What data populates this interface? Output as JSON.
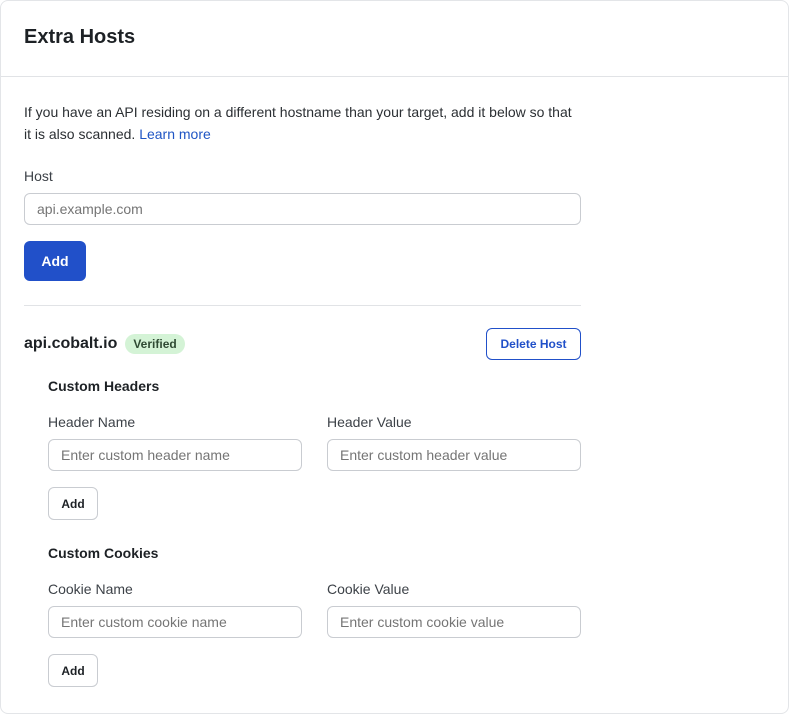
{
  "header": {
    "title": "Extra Hosts"
  },
  "description": {
    "text": "If you have an API residing on a different hostname than your target, add it below so that it is also scanned.",
    "link_label": "Learn more"
  },
  "host_form": {
    "label": "Host",
    "placeholder": "api.example.com",
    "value": "",
    "add_label": "Add"
  },
  "hosts": [
    {
      "name": "api.cobalt.io",
      "status_badge": "Verified",
      "delete_label": "Delete Host",
      "custom_headers": {
        "title": "Custom Headers",
        "name_label": "Header Name",
        "name_placeholder": "Enter custom header name",
        "value_label": "Header Value",
        "value_placeholder": "Enter custom header value",
        "add_label": "Add"
      },
      "custom_cookies": {
        "title": "Custom Cookies",
        "name_label": "Cookie Name",
        "name_placeholder": "Enter custom cookie name",
        "value_label": "Cookie Value",
        "value_placeholder": "Enter custom cookie value",
        "add_label": "Add"
      }
    }
  ],
  "colors": {
    "primary": "#2150c9",
    "link": "#1f55c4",
    "verified_bg": "#d4f3d6",
    "border": "#c9ccd1"
  }
}
